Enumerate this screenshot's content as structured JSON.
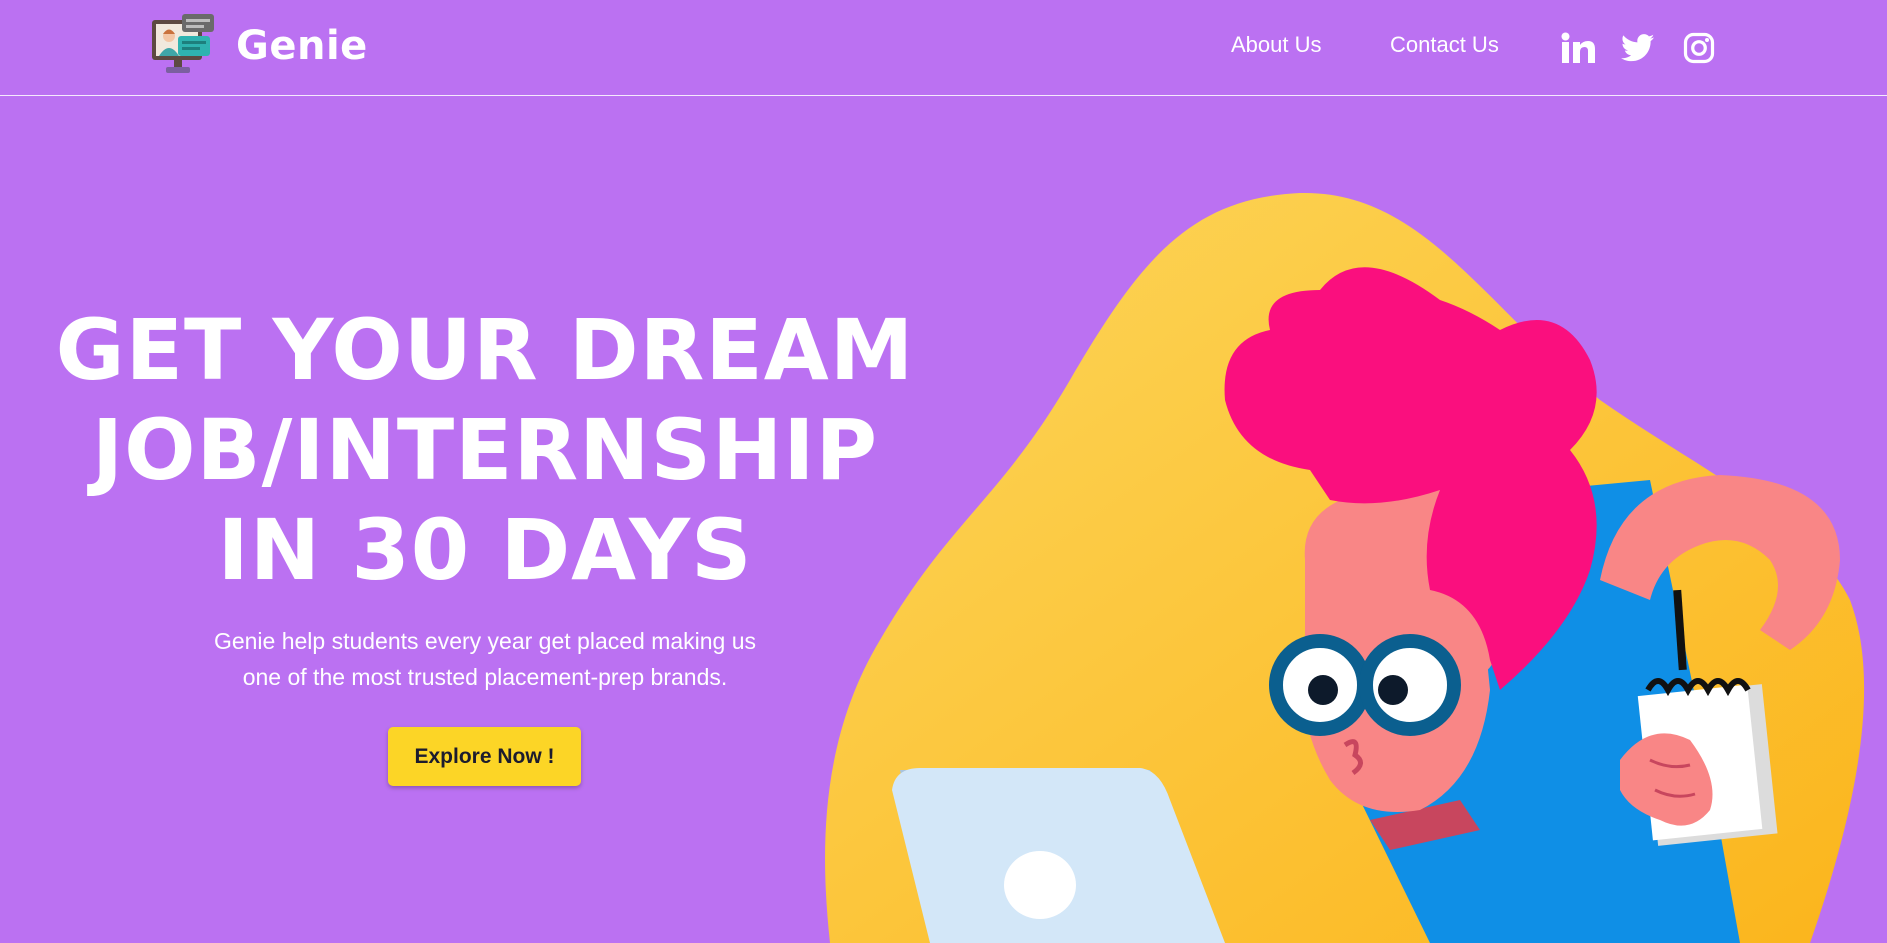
{
  "brand": {
    "name": "Genie",
    "logo_icon": "computer-chat-logo-icon"
  },
  "nav": {
    "about_label": "About Us",
    "contact_label": "Contact Us",
    "social": [
      "linkedin-icon",
      "twitter-icon",
      "instagram-icon"
    ]
  },
  "hero": {
    "heading_line1": "GET YOUR DREAM",
    "heading_line2": "JOB/INTERNSHIP",
    "heading_line3": "IN 30 DAYS",
    "sub_line1": "Genie help students every year get placed making us",
    "sub_line2": "one of the most trusted placement-prep brands.",
    "cta_label": "Explore Now !"
  },
  "colors": {
    "background": "#bb71f2",
    "cta": "#fcd526",
    "blob": "#fcc52a",
    "hair": "#fa0f7e",
    "shirt": "#0f8fe6",
    "skin": "#f98686"
  }
}
